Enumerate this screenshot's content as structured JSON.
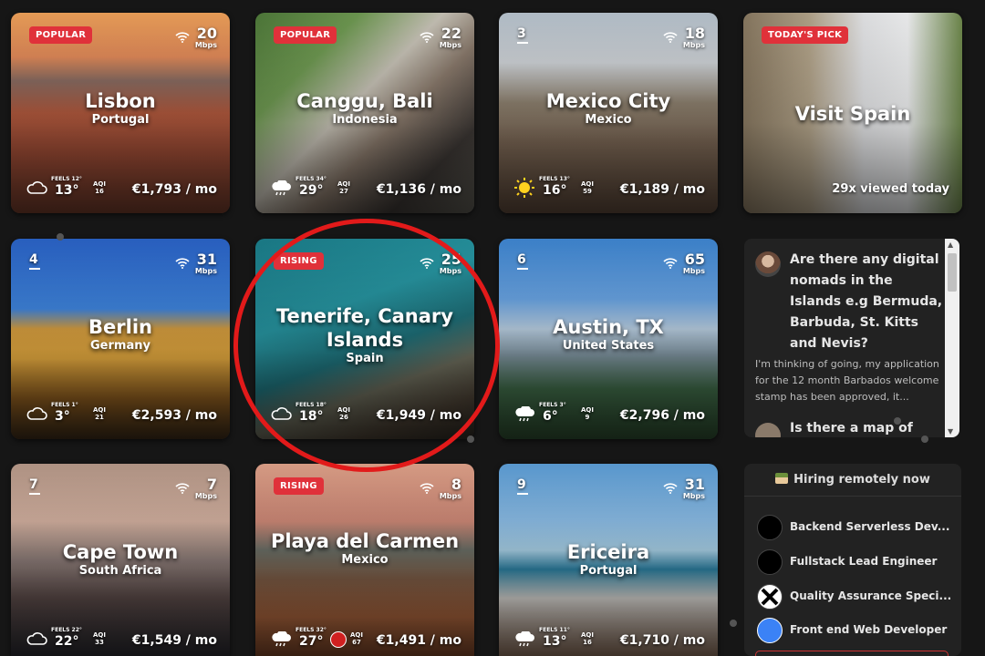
{
  "cards": [
    {
      "name": "lisbon",
      "badge": "POPULAR",
      "rank": "",
      "city": "Lisbon",
      "country": "Portugal",
      "wifi": "20",
      "wifi_unit": "Mbps",
      "feels": "FEELS 12°",
      "temp": "13°",
      "aqi_label": "AQI",
      "aqi": "16",
      "cost": "€1,793 / mo",
      "weather": "cloud-icon"
    },
    {
      "name": "canggu-bali",
      "badge": "POPULAR",
      "rank": "",
      "city": "Canggu, Bali",
      "country": "Indonesia",
      "wifi": "22",
      "wifi_unit": "Mbps",
      "feels": "FEELS 34°",
      "temp": "29°",
      "aqi_label": "AQI",
      "aqi": "27",
      "cost": "€1,136 / mo",
      "weather": "rain-icon"
    },
    {
      "name": "mexico-city",
      "badge": "",
      "rank": "3",
      "city": "Mexico City",
      "country": "Mexico",
      "wifi": "18",
      "wifi_unit": "Mbps",
      "feels": "FEELS 13°",
      "temp": "16°",
      "aqi_label": "AQI",
      "aqi": "59",
      "cost": "€1,189 / mo",
      "weather": "sun-icon"
    },
    {
      "name": "visit-spain",
      "badge": "TODAY'S PICK",
      "rank": "",
      "city": "Visit Spain",
      "country": "",
      "wifi": "",
      "wifi_unit": "",
      "feels": "",
      "temp": "",
      "aqi_label": "",
      "aqi": "",
      "cost": "29x viewed today",
      "weather": ""
    },
    {
      "name": "berlin",
      "badge": "",
      "rank": "4",
      "city": "Berlin",
      "country": "Germany",
      "wifi": "31",
      "wifi_unit": "Mbps",
      "feels": "FEELS 1°",
      "temp": "3°",
      "aqi_label": "AQI",
      "aqi": "21",
      "cost": "€2,593 / mo",
      "weather": "cloud-icon"
    },
    {
      "name": "tenerife",
      "badge": "RISING",
      "rank": "",
      "city": "Tenerife, Canary Islands",
      "country": "Spain",
      "wifi": "25",
      "wifi_unit": "Mbps",
      "feels": "FEELS 18°",
      "temp": "18°",
      "aqi_label": "AQI",
      "aqi": "26",
      "cost": "€1,949 / mo",
      "weather": "cloud-icon"
    },
    {
      "name": "austin",
      "badge": "",
      "rank": "6",
      "city": "Austin, TX",
      "country": "United States",
      "wifi": "65",
      "wifi_unit": "Mbps",
      "feels": "FEELS 3°",
      "temp": "6°",
      "aqi_label": "AQI",
      "aqi": "9",
      "cost": "€2,796 / mo",
      "weather": "rain-icon"
    },
    {
      "name": "cape-town",
      "badge": "",
      "rank": "7",
      "city": "Cape Town",
      "country": "South Africa",
      "wifi": "7",
      "wifi_unit": "Mbps",
      "feels": "FEELS 22°",
      "temp": "22°",
      "aqi_label": "AQI",
      "aqi": "33",
      "cost": "€1,549 / mo",
      "weather": "cloud-icon"
    },
    {
      "name": "playa-del-carmen",
      "badge": "RISING",
      "rank": "",
      "city": "Playa del Carmen",
      "country": "Mexico",
      "wifi": "8",
      "wifi_unit": "Mbps",
      "feels": "FEELS 32°",
      "temp": "27°",
      "aqi_label": "AQI",
      "aqi": "67",
      "cost": "€1,491 / mo",
      "weather": "rain-icon"
    },
    {
      "name": "ericeira",
      "badge": "",
      "rank": "9",
      "city": "Ericeira",
      "country": "Portugal",
      "wifi": "31",
      "wifi_unit": "Mbps",
      "feels": "FEELS 11°",
      "temp": "13°",
      "aqi_label": "AQI",
      "aqi": "16",
      "cost": "€1,710 / mo",
      "weather": "rain-icon"
    }
  ],
  "forum": {
    "title": "Are there any digital nomads in the Islands e.g Bermuda, Barbuda, St. Kitts and Nevis?",
    "body": "I'm thinking of going, my application for the 12 month Barbados welcome stamp has been approved, it...",
    "next_title": "Is there a map of"
  },
  "jobs": {
    "heading": "Hiring remotely now",
    "items": [
      {
        "title": "Backend Serverless Dev..."
      },
      {
        "title": "Fullstack Lead Engineer"
      },
      {
        "title": "Quality Assurance Speci..."
      },
      {
        "title": "Front end Web Developer"
      }
    ]
  },
  "colors": {
    "badge": "#e0313a",
    "annotation": "#e21a1a",
    "bg": "#161616"
  }
}
